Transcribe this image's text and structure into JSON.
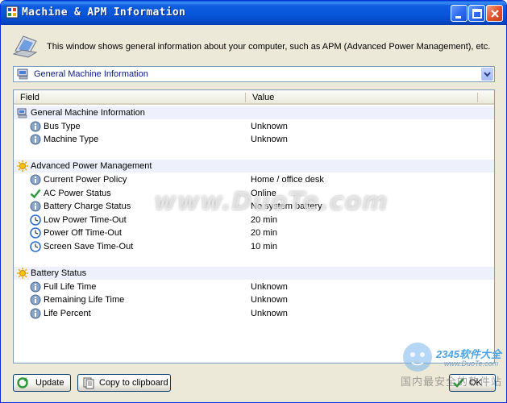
{
  "window": {
    "title": "Machine & APM Information"
  },
  "description": "This window shows general information about your computer, such as APM (Advanced Power Management), etc.",
  "selector": {
    "selected": "General Machine Information"
  },
  "table": {
    "headers": [
      "Field",
      "Value"
    ],
    "groups": [
      {
        "title": "General Machine Information",
        "icon": "computer-icon",
        "rows": [
          {
            "field": "Bus Type",
            "value": "Unknown",
            "icon": "info-icon"
          },
          {
            "field": "Machine Type",
            "value": "Unknown",
            "icon": "info-icon"
          }
        ]
      },
      {
        "title": "Advanced Power Management",
        "icon": "sun-icon",
        "rows": [
          {
            "field": "Current Power Policy",
            "value": "Home / office desk",
            "icon": "info-icon"
          },
          {
            "field": "AC Power Status",
            "value": "Online",
            "icon": "check-icon"
          },
          {
            "field": "Battery Charge Status",
            "value": "No system battery",
            "icon": "info-icon"
          },
          {
            "field": "Low Power Time-Out",
            "value": "20 min",
            "icon": "clock-icon"
          },
          {
            "field": "Power Off Time-Out",
            "value": "20 min",
            "icon": "clock-icon"
          },
          {
            "field": "Screen Save Time-Out",
            "value": "10 min",
            "icon": "clock-icon"
          }
        ]
      },
      {
        "title": "Battery Status",
        "icon": "sun-icon",
        "rows": [
          {
            "field": "Full Life Time",
            "value": "Unknown",
            "icon": "info-icon"
          },
          {
            "field": "Remaining Life Time",
            "value": "Unknown",
            "icon": "info-icon"
          },
          {
            "field": "Life Percent",
            "value": "Unknown",
            "icon": "info-icon"
          }
        ]
      }
    ]
  },
  "buttons": {
    "update": "Update",
    "copy": "Copy to clipboard",
    "ok": "OK"
  },
  "watermark": {
    "center": "www.DuoTe.com",
    "logo_number": "2345软件大全",
    "logo_url": "www.DuoTe.com",
    "logo_caption": "国内最安全的软件站"
  },
  "colors": {
    "titlebar": "#0654d8",
    "group_row": "#eef1fb",
    "window_bg": "#ece9d8"
  }
}
